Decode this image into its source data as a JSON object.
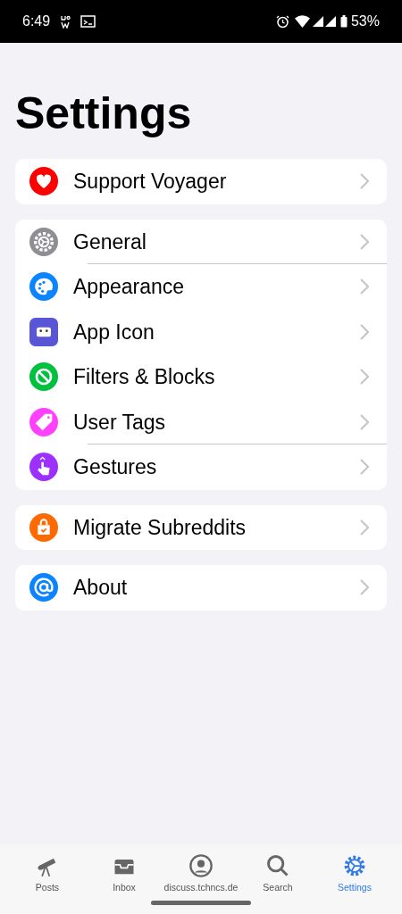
{
  "status_bar": {
    "time": "6:49",
    "battery": "53%"
  },
  "title": "Settings",
  "groups": [
    {
      "items": [
        {
          "label": "Support Voyager",
          "color": "#ff0000",
          "divider": false
        }
      ]
    },
    {
      "items": [
        {
          "label": "General",
          "color": "#8e8e93",
          "divider": true
        },
        {
          "label": "Appearance",
          "color": "#0a84ff",
          "divider": false
        },
        {
          "label": "App Icon",
          "color": "#5856d6",
          "divider": false
        },
        {
          "label": "Filters & Blocks",
          "color": "#00c040",
          "divider": false
        },
        {
          "label": "User Tags",
          "color": "#ff40ff",
          "divider": true
        },
        {
          "label": "Gestures",
          "color": "#9b30ff",
          "divider": false
        }
      ]
    },
    {
      "items": [
        {
          "label": "Migrate Subreddits",
          "color": "#ff6a00",
          "divider": false
        }
      ]
    },
    {
      "items": [
        {
          "label": "About",
          "color": "#0a84ff",
          "divider": false
        }
      ]
    }
  ],
  "tabs": [
    {
      "label": "Posts",
      "selected": false
    },
    {
      "label": "Inbox",
      "selected": false
    },
    {
      "label": "discuss.tchncs.de",
      "selected": false
    },
    {
      "label": "Search",
      "selected": false
    },
    {
      "label": "Settings",
      "selected": true
    }
  ]
}
